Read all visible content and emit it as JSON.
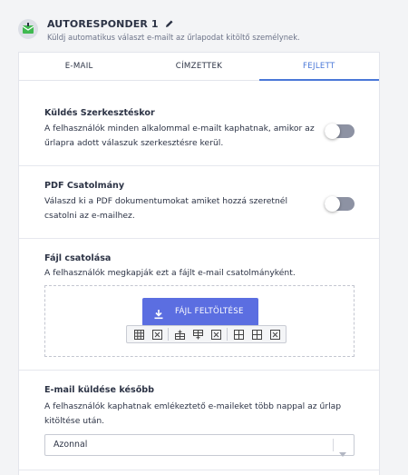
{
  "header": {
    "title": "AUTORESPONDER 1",
    "subtitle": "Küldj automatikus választ e-mailt az űrlapodat kitöltő személynek."
  },
  "tabs": [
    {
      "label": "E-MAIL",
      "active": false
    },
    {
      "label": "CÍMZETTEK",
      "active": false
    },
    {
      "label": "FEJLETT",
      "active": true
    }
  ],
  "sections": {
    "send_on_edit": {
      "title": "Küldés Szerkesztéskor",
      "description": "A felhasználók minden alkalommal e-mailt kaphatnak, amikor az űrlapra adott válaszuk szerkesztésre kerül.",
      "enabled": false
    },
    "pdf_attachment": {
      "title": "PDF Csatolmány",
      "description": "Válaszd ki a PDF dokumentumokat amiket hozzá szeretnél csatolni az e-mailhez.",
      "enabled": false
    },
    "file_attach": {
      "title": "Fájl csatolása",
      "description": "A felhasználók megkapják ezt a fájlt e-mail csatolmányként.",
      "upload_label": "FÁJL FELTÖLTÉSE"
    },
    "send_later": {
      "title": "E-mail küldése később",
      "description": "A felhasználók kaphatnak emlékeztető e-maileket több nappal az űrlap kitöltése után.",
      "selected": "Azonnal"
    }
  },
  "colors": {
    "accent": "#4a78d8",
    "upload_button": "#5b6ee1",
    "toggle_off": "#8d92a3"
  },
  "icons": [
    "autoresponder-icon",
    "pencil-icon",
    "download-icon",
    "table-icon",
    "close-icon",
    "insert-row-above-icon",
    "insert-row-below-icon",
    "insert-column-left-icon",
    "insert-column-right-icon",
    "chevron-down-icon"
  ]
}
